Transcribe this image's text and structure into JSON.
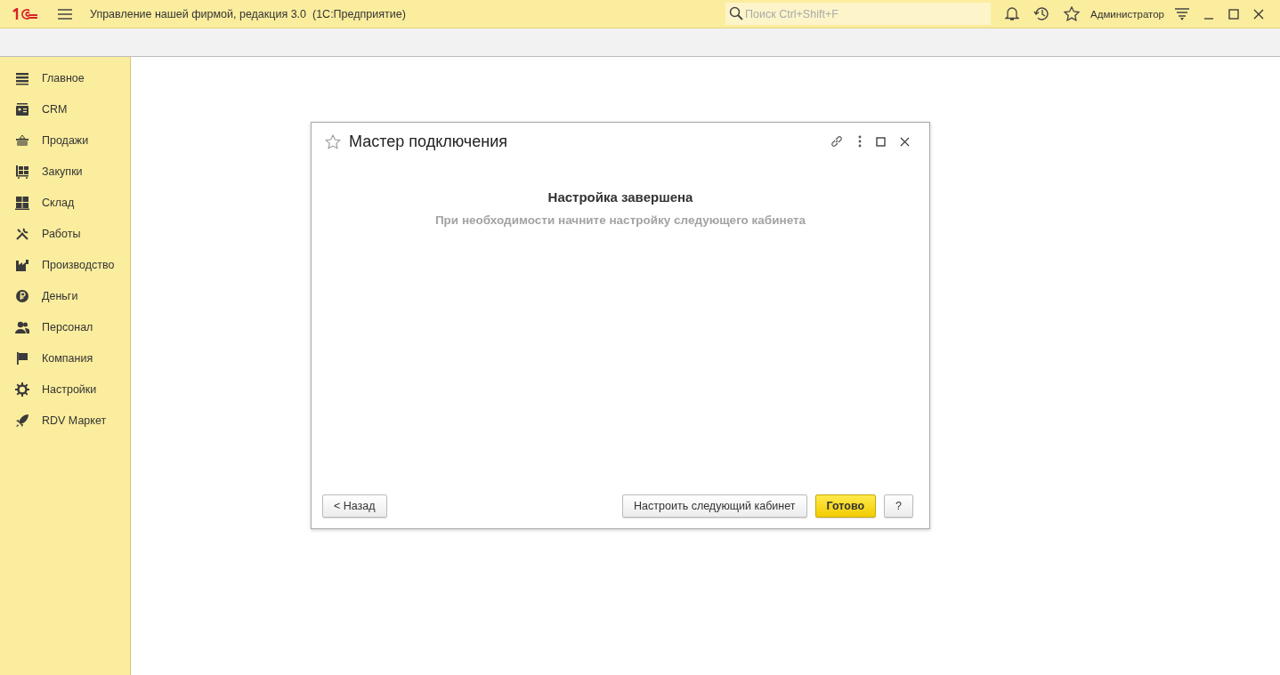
{
  "app_bar": {
    "title": "Управление нашей фирмой, редакция 3.0  (1С:Предприятие)",
    "search": {
      "placeholder": "Поиск Ctrl+Shift+F"
    },
    "user": "Администратор"
  },
  "sidebar": {
    "items": [
      {
        "label": "Главное",
        "kind": "main"
      },
      {
        "label": "CRM",
        "kind": "crm"
      },
      {
        "label": "Продажи",
        "kind": "sales"
      },
      {
        "label": "Закупки",
        "kind": "purchases"
      },
      {
        "label": "Склад",
        "kind": "warehouse"
      },
      {
        "label": "Работы",
        "kind": "works"
      },
      {
        "label": "Производство",
        "kind": "production"
      },
      {
        "label": "Деньги",
        "kind": "money"
      },
      {
        "label": "Персонал",
        "kind": "staff"
      },
      {
        "label": "Компания",
        "kind": "company"
      },
      {
        "label": "Настройки",
        "kind": "settings"
      },
      {
        "label": "RDV Маркет",
        "kind": "market"
      }
    ]
  },
  "dialog": {
    "title": "Мастер подключения",
    "heading": "Настройка завершена",
    "message": "При необходимости начните настройку следующего кабинета",
    "buttons_left": [
      {
        "label": "< Назад",
        "kind": "default"
      }
    ],
    "buttons_right": [
      {
        "label": "Настроить следующий кабинет",
        "kind": "default"
      },
      {
        "label": "Готово",
        "kind": "primary"
      },
      {
        "label": "?",
        "kind": "default"
      }
    ]
  }
}
